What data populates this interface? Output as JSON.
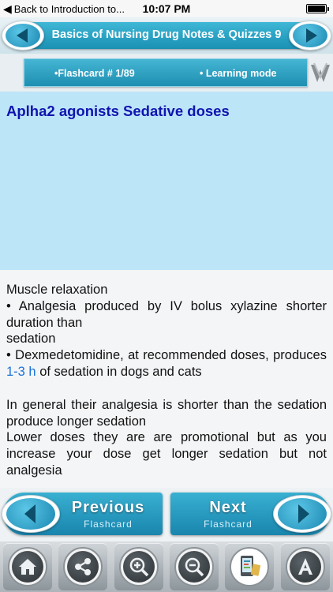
{
  "status_bar": {
    "back_label": "Back to Introduction to...",
    "time": "10:07 PM"
  },
  "header": {
    "title": "Basics of Nursing Drug Notes & Quizzes 9"
  },
  "info": {
    "flashcard": "•Flashcard #  1/89",
    "mode": "• Learning mode"
  },
  "card": {
    "question": "Aplha2 agonists Sedative doses",
    "answer": {
      "line1": "Muscle relaxation",
      "line2": "• Analgesia produced by IV bolus xylazine shorter duration than",
      "line3": "sedation",
      "line4_pre": "• Dexmedetomidine, at recommended doses, produces ",
      "line4_hl": "1-3 h",
      "line4_post": " of sedation in dogs and cats",
      "line5": "In general their analgesia is shorter than the sedation produce longer sedation",
      "line6": "Lower doses they are are promotional but as you increase your dose get longer sedation but not analgesia"
    }
  },
  "nav": {
    "previous_main": "Previous",
    "previous_sub": "Flashcard",
    "next_main": "Next",
    "next_sub": "Flashcard"
  },
  "toolbar": {
    "icons": [
      "home-icon",
      "share-icon",
      "zoom-in-icon",
      "zoom-out-icon",
      "flashcard-app-icon",
      "font-size-icon"
    ]
  },
  "colors": {
    "accent": "#1f93b7",
    "question_bg": "#bde5f8",
    "question_text": "#1014b0",
    "highlight": "#1a73d9"
  }
}
